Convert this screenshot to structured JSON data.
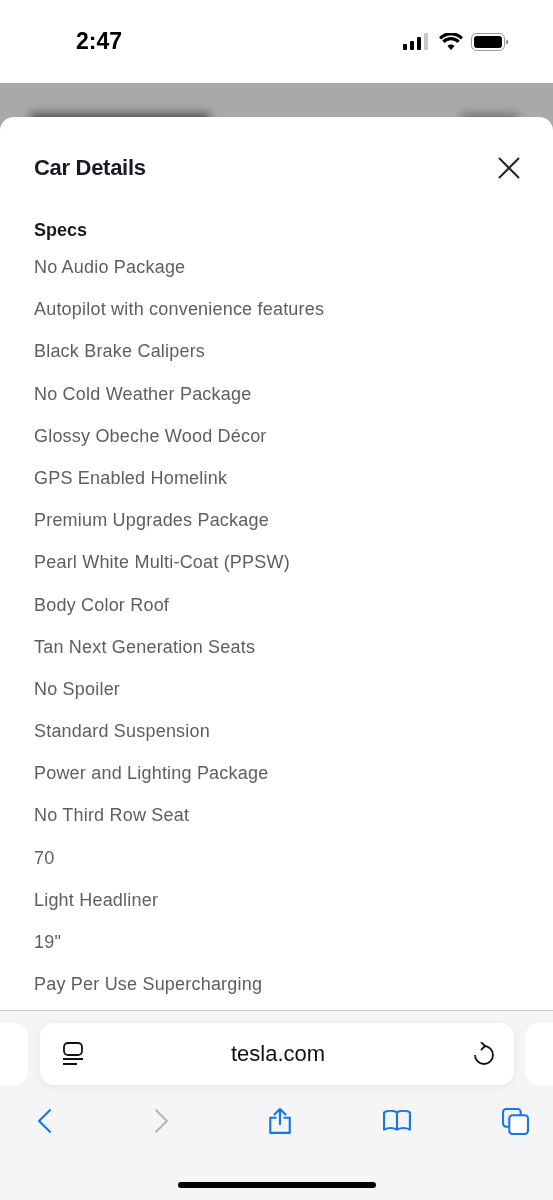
{
  "status_bar": {
    "time": "2:47"
  },
  "sheet": {
    "title": "Car Details",
    "section": "Specs",
    "items": [
      "No Audio Package",
      "Autopilot with convenience features",
      "Black Brake Calipers",
      "No Cold Weather Package",
      "Glossy Obeche Wood Décor",
      "GPS Enabled Homelink",
      "Premium Upgrades Package",
      "Pearl White Multi-Coat (PPSW)",
      "Body Color Roof",
      "Tan Next Generation Seats",
      "No Spoiler",
      "Standard Suspension",
      "Power and Lighting Package",
      "No Third Row Seat",
      "70",
      "Light Headliner",
      "19\"",
      "Pay Per Use Supercharging"
    ]
  },
  "address_bar": {
    "url": "tesla.com"
  },
  "toolbar": [
    {
      "kind": "back",
      "disabled": false
    },
    {
      "kind": "forward",
      "disabled": true
    },
    {
      "kind": "share",
      "disabled": false
    },
    {
      "kind": "bookmarks",
      "disabled": false
    },
    {
      "kind": "tabs",
      "disabled": false
    }
  ]
}
